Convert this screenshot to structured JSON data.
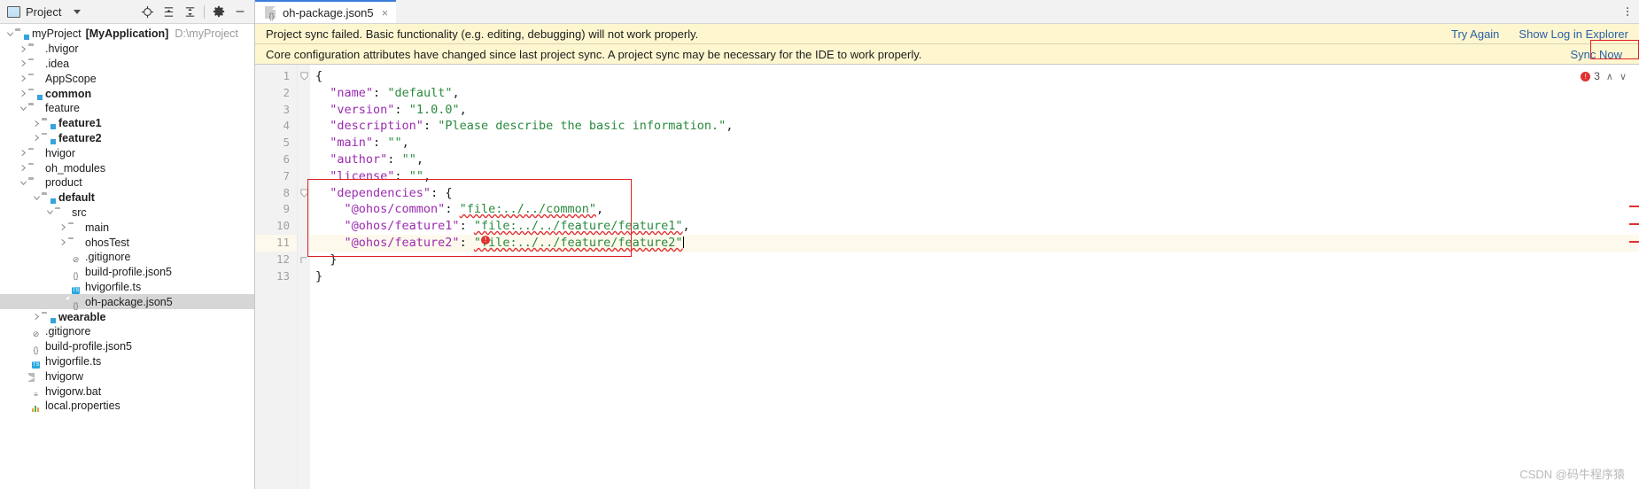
{
  "project_panel": {
    "title": "Project",
    "icons": [
      "project-icon",
      "chevron-down-icon",
      "locate-icon",
      "expand-all-icon",
      "collapse-all-icon",
      "settings-gear-icon",
      "hide-icon"
    ],
    "tree": [
      {
        "indent": 0,
        "arrow": "v",
        "icon": "folder-module",
        "label": "myProject",
        "bold_label": "[MyApplication]",
        "path": "D:\\myProject",
        "selected": false
      },
      {
        "indent": 1,
        "arrow": ">",
        "icon": "folder",
        "label": ".hvigor",
        "selected": false
      },
      {
        "indent": 1,
        "arrow": ">",
        "icon": "folder",
        "label": ".idea",
        "selected": false
      },
      {
        "indent": 1,
        "arrow": ">",
        "icon": "folder",
        "label": "AppScope",
        "selected": false
      },
      {
        "indent": 1,
        "arrow": ">",
        "icon": "folder-module",
        "label": "common",
        "bold": true,
        "selected": false
      },
      {
        "indent": 1,
        "arrow": "v",
        "icon": "folder",
        "label": "feature",
        "selected": false
      },
      {
        "indent": 2,
        "arrow": ">",
        "icon": "folder-module",
        "label": "feature1",
        "bold": true,
        "selected": false
      },
      {
        "indent": 2,
        "arrow": ">",
        "icon": "folder-module",
        "label": "feature2",
        "bold": true,
        "selected": false
      },
      {
        "indent": 1,
        "arrow": ">",
        "icon": "folder",
        "label": "hvigor",
        "selected": false
      },
      {
        "indent": 1,
        "arrow": ">",
        "icon": "folder",
        "label": "oh_modules",
        "selected": false
      },
      {
        "indent": 1,
        "arrow": "v",
        "icon": "folder",
        "label": "product",
        "selected": false
      },
      {
        "indent": 2,
        "arrow": "v",
        "icon": "folder-module",
        "label": "default",
        "bold": true,
        "selected": false
      },
      {
        "indent": 3,
        "arrow": "v",
        "icon": "folder",
        "label": "src",
        "selected": false
      },
      {
        "indent": 4,
        "arrow": ">",
        "icon": "folder",
        "label": "main",
        "selected": false
      },
      {
        "indent": 4,
        "arrow": ">",
        "icon": "folder",
        "label": "ohosTest",
        "selected": false
      },
      {
        "indent": 4,
        "arrow": "",
        "icon": "file-gitignore",
        "label": ".gitignore",
        "selected": false
      },
      {
        "indent": 4,
        "arrow": "",
        "icon": "file-json5",
        "label": "build-profile.json5",
        "selected": false
      },
      {
        "indent": 4,
        "arrow": "",
        "icon": "file-ts",
        "label": "hvigorfile.ts",
        "selected": false
      },
      {
        "indent": 4,
        "arrow": "",
        "icon": "file-json5",
        "label": "oh-package.json5",
        "selected": true
      },
      {
        "indent": 2,
        "arrow": ">",
        "icon": "folder-module",
        "label": "wearable",
        "bold": true,
        "selected": false
      },
      {
        "indent": 1,
        "arrow": "",
        "icon": "file-gitignore",
        "label": ".gitignore",
        "selected": false
      },
      {
        "indent": 1,
        "arrow": "",
        "icon": "file-json5",
        "label": "build-profile.json5",
        "selected": false
      },
      {
        "indent": 1,
        "arrow": "",
        "icon": "file-ts",
        "label": "hvigorfile.ts",
        "selected": false
      },
      {
        "indent": 1,
        "arrow": "",
        "icon": "file-exec",
        "label": "hvigorw",
        "selected": false
      },
      {
        "indent": 1,
        "arrow": "",
        "icon": "file-bat",
        "label": "hvigorw.bat",
        "selected": false
      },
      {
        "indent": 1,
        "arrow": "",
        "icon": "file-properties",
        "label": "local.properties",
        "selected": false
      }
    ]
  },
  "editor": {
    "tab": {
      "label": "oh-package.json5",
      "icon": "json5-file-icon",
      "close": "×"
    },
    "notifications": [
      {
        "message": "Project sync failed. Basic functionality (e.g. editing, debugging) will not work properly.",
        "actions": [
          "Try Again",
          "Show Log in Explorer"
        ]
      },
      {
        "message": "Core configuration attributes have changed since last project sync. A project sync may be necessary for the IDE to work properly.",
        "actions": [
          "Sync Now"
        ]
      }
    ],
    "inspector": {
      "error_count": "3",
      "up": "∧",
      "down": "∨"
    },
    "line_numbers": [
      "1",
      "2",
      "3",
      "4",
      "5",
      "6",
      "7",
      "8",
      "9",
      "10",
      "11",
      "12",
      "13"
    ],
    "highlighted_line": 11,
    "code_lines": [
      {
        "n": 1,
        "tokens": [
          {
            "t": "{",
            "c": "p"
          }
        ]
      },
      {
        "n": 2,
        "tokens": [
          {
            "t": "  ",
            "c": "p"
          },
          {
            "t": "\"name\"",
            "c": "k"
          },
          {
            "t": ": ",
            "c": "p"
          },
          {
            "t": "\"default\"",
            "c": "s"
          },
          {
            "t": ",",
            "c": "p"
          }
        ]
      },
      {
        "n": 3,
        "tokens": [
          {
            "t": "  ",
            "c": "p"
          },
          {
            "t": "\"version\"",
            "c": "k"
          },
          {
            "t": ": ",
            "c": "p"
          },
          {
            "t": "\"1.0.0\"",
            "c": "s"
          },
          {
            "t": ",",
            "c": "p"
          }
        ]
      },
      {
        "n": 4,
        "tokens": [
          {
            "t": "  ",
            "c": "p"
          },
          {
            "t": "\"description\"",
            "c": "k"
          },
          {
            "t": ": ",
            "c": "p"
          },
          {
            "t": "\"Please describe the basic information.\"",
            "c": "s"
          },
          {
            "t": ",",
            "c": "p"
          }
        ]
      },
      {
        "n": 5,
        "tokens": [
          {
            "t": "  ",
            "c": "p"
          },
          {
            "t": "\"main\"",
            "c": "k"
          },
          {
            "t": ": ",
            "c": "p"
          },
          {
            "t": "\"\"",
            "c": "s"
          },
          {
            "t": ",",
            "c": "p"
          }
        ]
      },
      {
        "n": 6,
        "tokens": [
          {
            "t": "  ",
            "c": "p"
          },
          {
            "t": "\"author\"",
            "c": "k"
          },
          {
            "t": ": ",
            "c": "p"
          },
          {
            "t": "\"\"",
            "c": "s"
          },
          {
            "t": ",",
            "c": "p"
          }
        ]
      },
      {
        "n": 7,
        "tokens": [
          {
            "t": "  ",
            "c": "p"
          },
          {
            "t": "\"license\"",
            "c": "k"
          },
          {
            "t": ": ",
            "c": "p"
          },
          {
            "t": "\"\"",
            "c": "s"
          },
          {
            "t": ",",
            "c": "p"
          }
        ]
      },
      {
        "n": 8,
        "tokens": [
          {
            "t": "  ",
            "c": "p"
          },
          {
            "t": "\"dependencies\"",
            "c": "k"
          },
          {
            "t": ": ",
            "c": "p"
          },
          {
            "t": "{",
            "c": "p"
          }
        ]
      },
      {
        "n": 9,
        "tokens": [
          {
            "t": "    ",
            "c": "p"
          },
          {
            "t": "\"@ohos/common\"",
            "c": "k"
          },
          {
            "t": ": ",
            "c": "p"
          },
          {
            "t": "\"file:../../common\"",
            "c": "s sq"
          },
          {
            "t": ",",
            "c": "p"
          }
        ]
      },
      {
        "n": 10,
        "tokens": [
          {
            "t": "    ",
            "c": "p"
          },
          {
            "t": "\"@ohos/feature1\"",
            "c": "k"
          },
          {
            "t": ": ",
            "c": "p"
          },
          {
            "t": "\"file:../../feature/feature1\"",
            "c": "s sq"
          },
          {
            "t": ",",
            "c": "p"
          }
        ]
      },
      {
        "n": 11,
        "tokens": [
          {
            "t": "    ",
            "c": "p"
          },
          {
            "t": "\"@ohos/feature2\"",
            "c": "k"
          },
          {
            "t": ": ",
            "c": "p"
          },
          {
            "t": "\"file:../../feature/feature2\"",
            "c": "s sq"
          }
        ]
      },
      {
        "n": 12,
        "tokens": [
          {
            "t": "  ",
            "c": "p"
          },
          {
            "t": "}",
            "c": "p"
          }
        ]
      },
      {
        "n": 13,
        "tokens": [
          {
            "t": "}",
            "c": "p"
          }
        ]
      }
    ],
    "annotation_color": "#e02020"
  },
  "watermark": "CSDN @码牛程序猿"
}
